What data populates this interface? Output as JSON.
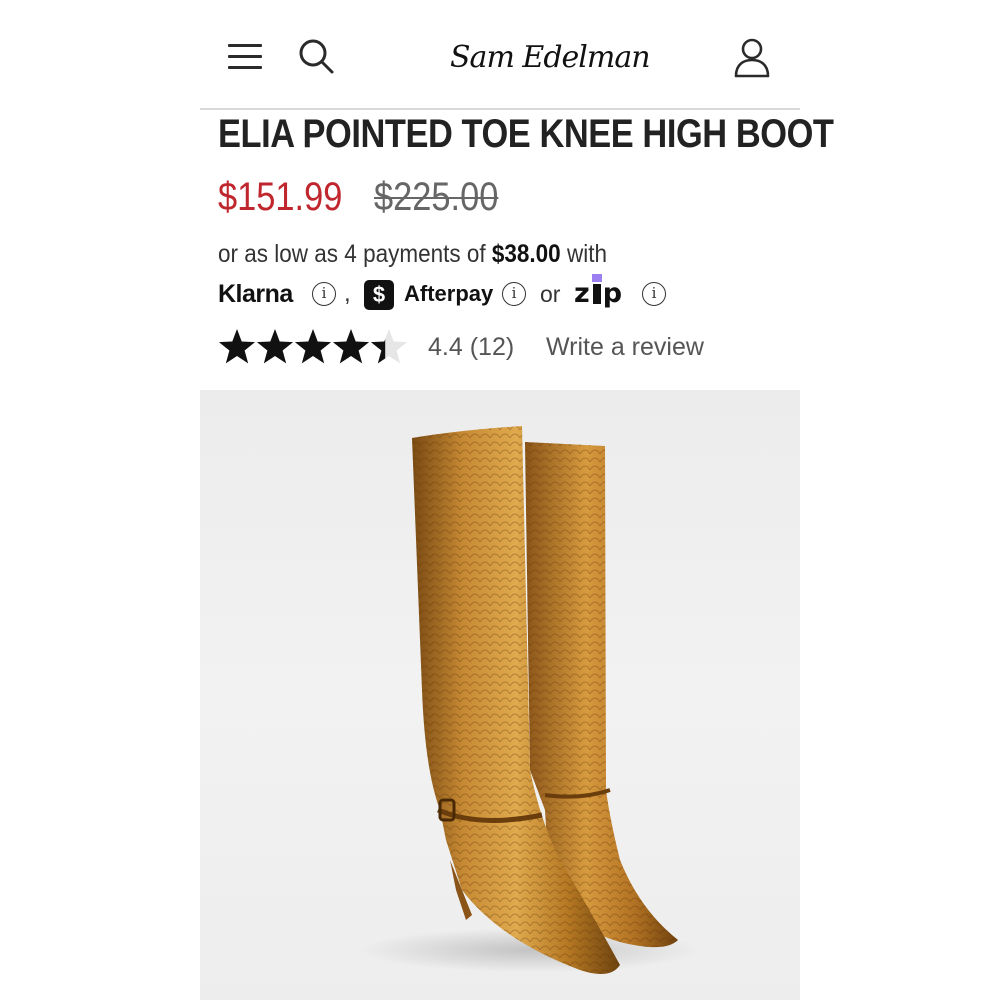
{
  "header": {
    "brand": "Sam Edelman",
    "menu_icon": "hamburger-menu-icon",
    "search_icon": "search-icon",
    "account_icon": "account-icon"
  },
  "product": {
    "title": "ELIA POINTED TOE KNEE HIGH BOOT",
    "sale_price": "$151.99",
    "original_price": "$225.00",
    "sale_color": "#c0262d"
  },
  "installments": {
    "prefix": "or as low as 4 payments of ",
    "amount": "$38.00",
    "suffix": " with",
    "providers": {
      "klarna": "Klarna",
      "separator": ",",
      "afterpay": "Afterpay",
      "afterpay_badge": "$",
      "or": "or",
      "zip_left": "z",
      "zip_right": "p",
      "info_glyph": "i"
    }
  },
  "rating": {
    "stars": 4.4,
    "max_stars": 5,
    "value": "4.4",
    "count": "(12)",
    "write_review": "Write a review"
  },
  "image": {
    "alt": "Gold snake-embossed pointed toe knee high boots with stiletto heels"
  }
}
